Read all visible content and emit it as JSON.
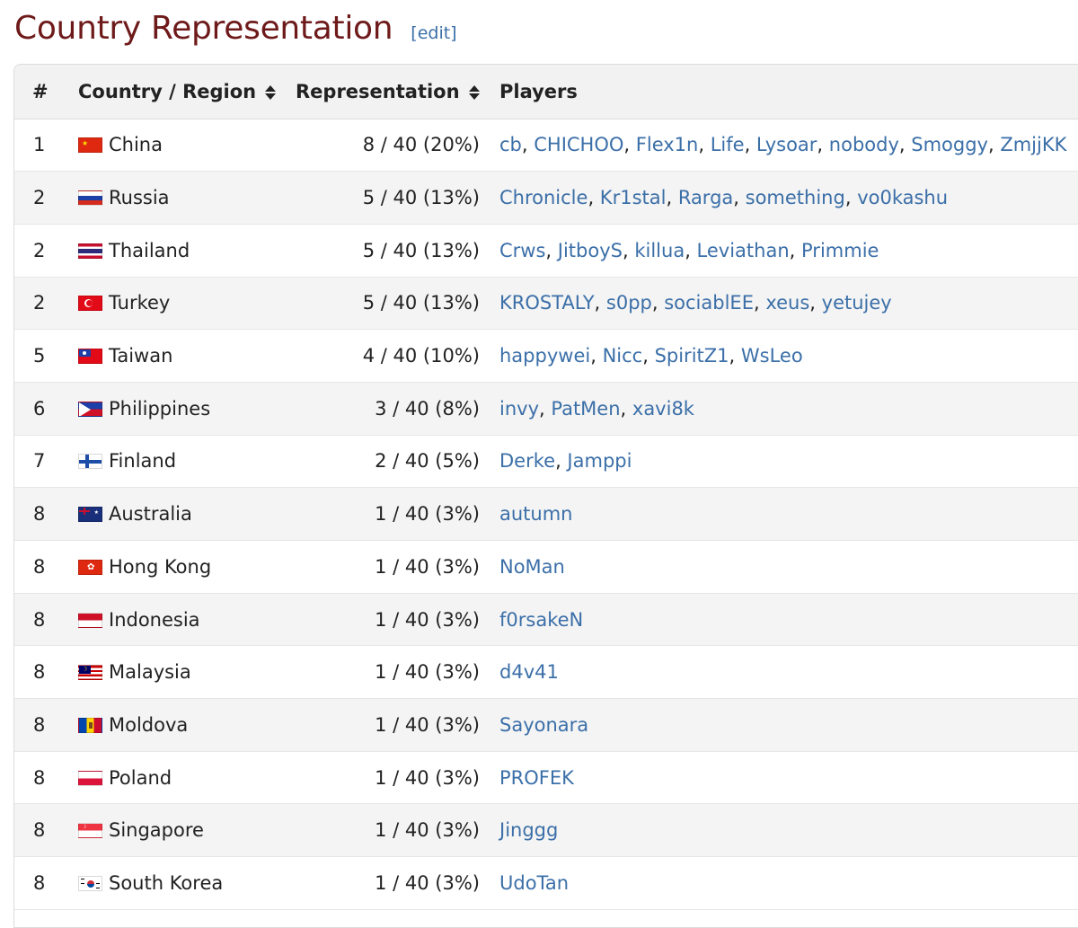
{
  "section": {
    "title": "Country Representation",
    "edit_label": "[edit]"
  },
  "table": {
    "headers": {
      "num": "#",
      "country": "Country / Region",
      "representation": "Representation",
      "players": "Players"
    },
    "rows": [
      {
        "rank": "1",
        "country": "China",
        "flag": "china-flag-icon",
        "representation": "8 / 40 (20%)",
        "players": [
          "cb",
          "CHICHOO",
          "Flex1n",
          "Life",
          "Lysoar",
          "nobody",
          "Smoggy",
          "ZmjjKK"
        ]
      },
      {
        "rank": "2",
        "country": "Russia",
        "flag": "russia-flag-icon",
        "representation": "5 / 40 (13%)",
        "players": [
          "Chronicle",
          "Kr1stal",
          "Rarga",
          "something",
          "vo0kashu"
        ]
      },
      {
        "rank": "2",
        "country": "Thailand",
        "flag": "thailand-flag-icon",
        "representation": "5 / 40 (13%)",
        "players": [
          "Crws",
          "JitboyS",
          "killua",
          "Leviathan",
          "Primmie"
        ]
      },
      {
        "rank": "2",
        "country": "Turkey",
        "flag": "turkey-flag-icon",
        "representation": "5 / 40 (13%)",
        "players": [
          "KROSTALY",
          "s0pp",
          "sociablEE",
          "xeus",
          "yetujey"
        ]
      },
      {
        "rank": "5",
        "country": "Taiwan",
        "flag": "taiwan-flag-icon",
        "representation": "4 / 40 (10%)",
        "players": [
          "happywei",
          "Nicc",
          "SpiritZ1",
          "WsLeo"
        ]
      },
      {
        "rank": "6",
        "country": "Philippines",
        "flag": "philippines-flag-icon",
        "representation": "3 / 40 (8%)",
        "players": [
          "invy",
          "PatMen",
          "xavi8k"
        ]
      },
      {
        "rank": "7",
        "country": "Finland",
        "flag": "finland-flag-icon",
        "representation": "2 / 40 (5%)",
        "players": [
          "Derke",
          "Jamppi"
        ]
      },
      {
        "rank": "8",
        "country": "Australia",
        "flag": "australia-flag-icon",
        "representation": "1 / 40 (3%)",
        "players": [
          "autumn"
        ]
      },
      {
        "rank": "8",
        "country": "Hong Kong",
        "flag": "hong-kong-flag-icon",
        "representation": "1 / 40 (3%)",
        "players": [
          "NoMan"
        ]
      },
      {
        "rank": "8",
        "country": "Indonesia",
        "flag": "indonesia-flag-icon",
        "representation": "1 / 40 (3%)",
        "players": [
          "f0rsakeN"
        ]
      },
      {
        "rank": "8",
        "country": "Malaysia",
        "flag": "malaysia-flag-icon",
        "representation": "1 / 40 (3%)",
        "players": [
          "d4v41"
        ]
      },
      {
        "rank": "8",
        "country": "Moldova",
        "flag": "moldova-flag-icon",
        "representation": "1 / 40 (3%)",
        "players": [
          "Sayonara"
        ]
      },
      {
        "rank": "8",
        "country": "Poland",
        "flag": "poland-flag-icon",
        "representation": "1 / 40 (3%)",
        "players": [
          "PROFEK"
        ]
      },
      {
        "rank": "8",
        "country": "Singapore",
        "flag": "singapore-flag-icon",
        "representation": "1 / 40 (3%)",
        "players": [
          "Jinggg"
        ]
      },
      {
        "rank": "8",
        "country": "South Korea",
        "flag": "south-korea-flag-icon",
        "representation": "1 / 40 (3%)",
        "players": [
          "UdoTan"
        ]
      }
    ]
  },
  "colors": {
    "heading": "#6e1a1a",
    "link": "#3b6fa8",
    "header_bg": "#f2f2f2",
    "stripe_bg": "#f4f4f4"
  }
}
